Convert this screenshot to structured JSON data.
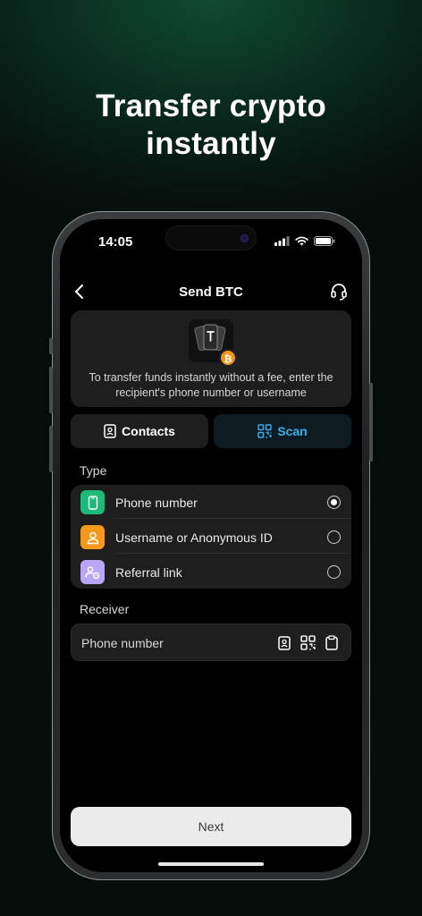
{
  "headline": {
    "line1": "Transfer crypto",
    "line2": "instantly"
  },
  "status_bar": {
    "time": "14:05"
  },
  "nav": {
    "title": "Send BTC"
  },
  "info": {
    "coin_symbol": "₿",
    "description": "To transfer funds instantly without a fee, enter the recipient's phone number or username"
  },
  "tabs": {
    "contacts": "Contacts",
    "scan": "Scan"
  },
  "type_section": {
    "label": "Type",
    "options": [
      {
        "label": "Phone number",
        "selected": true,
        "icon": "phone-icon",
        "color": "#1fb97a"
      },
      {
        "label": "Username or Anonymous ID",
        "selected": false,
        "icon": "user-icon",
        "color": "#f39a1c"
      },
      {
        "label": "Referral link",
        "selected": false,
        "icon": "referral-icon",
        "color": "#b9a7f5"
      }
    ]
  },
  "receiver": {
    "label": "Receiver",
    "placeholder": "Phone number"
  },
  "next_button": {
    "label": "Next"
  },
  "colors": {
    "accent_blue": "#3ab0f0",
    "card": "#1e1e1f",
    "background": "#000000"
  }
}
